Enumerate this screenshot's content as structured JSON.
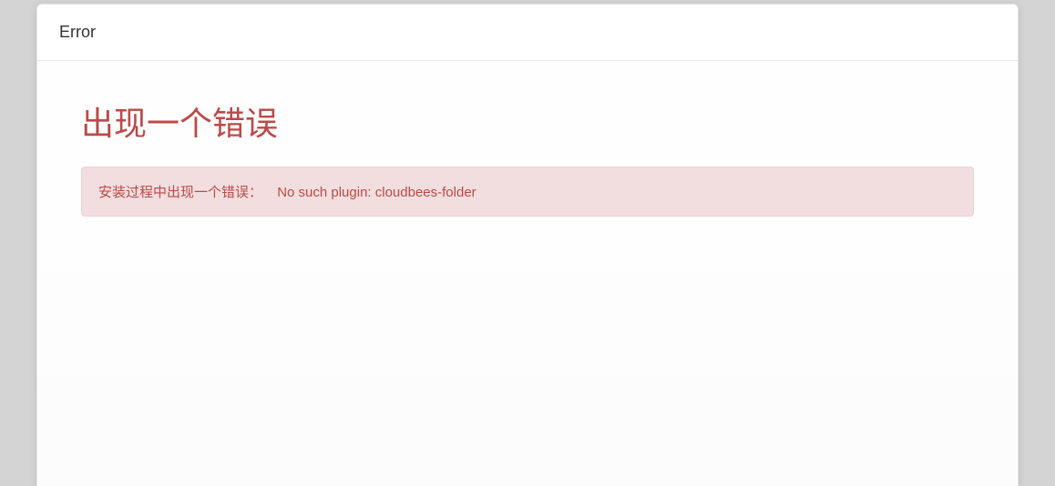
{
  "dialog": {
    "title": "Error"
  },
  "content": {
    "heading": "出现一个错误",
    "alert_prefix": "安装过程中出现一个错误：",
    "alert_message": "No such plugin: cloudbees-folder"
  }
}
